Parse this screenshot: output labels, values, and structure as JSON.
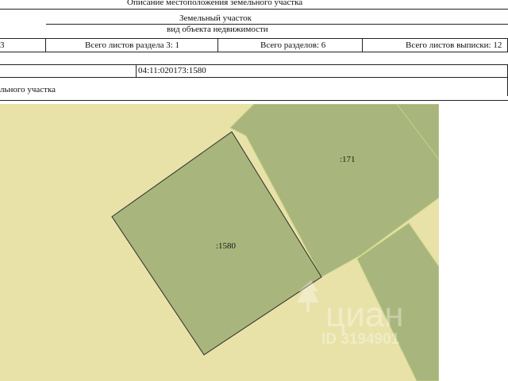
{
  "header": {
    "description_title": "Описание местоположения земельного участка",
    "object_type": "Земельный участок",
    "object_type_caption": "вид объекта недвижимости"
  },
  "sheet_row": {
    "section_number": "3",
    "section_sheets": "Всего листов раздела 3: 1",
    "total_sections": "Всего разделов: 6",
    "total_sheets": "Всего листов выписки: 12"
  },
  "cadastral": {
    "number": "04:11:020173:1580"
  },
  "plan_caption": "льного участка",
  "map": {
    "colors": {
      "background": "#e8e2a9",
      "parcel": "#a8b57c",
      "border": "#2d2d2d",
      "edge_light": "#c6d084"
    },
    "labels": {
      "main_parcel": ":1580",
      "neighbor_parcel": ":171"
    }
  },
  "watermark": {
    "brand": "циан",
    "id_text": "ID 3194901"
  }
}
